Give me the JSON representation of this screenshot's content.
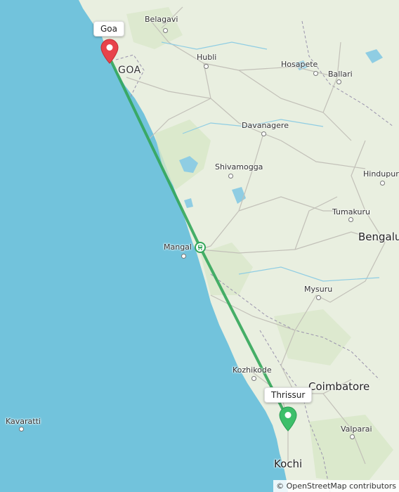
{
  "map": {
    "attribution": "© OpenStreetMap contributors",
    "colors": {
      "sea": "#72c3dc",
      "land": "#e9efe0",
      "route": "#33a65a",
      "origin_pin": "#e8434b",
      "destination_pin": "#3dbf6a"
    },
    "route": {
      "from": "Goa",
      "to": "Thrissur",
      "via_icon": "train-station-icon"
    },
    "markers": {
      "start_label": "Goa",
      "end_label": "Thrissur"
    },
    "places": {
      "belagavi": "Belagavi",
      "goa_state": "GOA",
      "hubli": "Hubli",
      "hosapete": "Hosapete",
      "ballari": "Ballari",
      "davanagere": "Davanagere",
      "shivamogga": "Shivamogga",
      "hindupur": "Hindupur",
      "tumakuru": "Tumakuru",
      "bengaluru": "Bengalu",
      "mangaluru": "Mangal",
      "mysuru": "Mysuru",
      "kozhikode": "Kozhikode",
      "coimbatore": "Coimbatore",
      "valparai": "Valparai",
      "kavaratti": "Kavaratti",
      "kochi": "Kochi"
    }
  }
}
